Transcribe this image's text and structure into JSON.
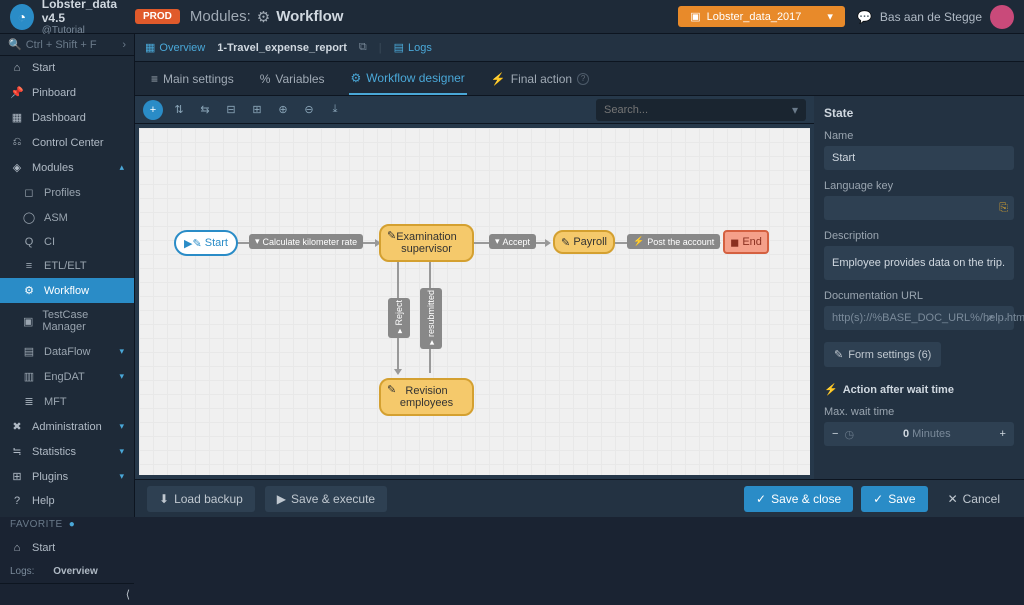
{
  "app": {
    "name": "Lobster_data v4.5",
    "subtitle": "@Tutorial"
  },
  "header": {
    "env_badge": "PROD",
    "module_label": "Modules:",
    "page_title": "Workflow",
    "project": "Lobster_data_2017",
    "user": "Bas aan de Stegge"
  },
  "sidebar": {
    "search_placeholder": "Ctrl + Shift + F",
    "items": [
      {
        "icon": "⌂",
        "label": "Start"
      },
      {
        "icon": "📌",
        "label": "Pinboard"
      },
      {
        "icon": "▦",
        "label": "Dashboard"
      },
      {
        "icon": "⎌",
        "label": "Control Center"
      },
      {
        "icon": "◈",
        "label": "Modules"
      }
    ],
    "modules": [
      {
        "icon": "◻",
        "label": "Profiles"
      },
      {
        "icon": "◯",
        "label": "ASM"
      },
      {
        "icon": "Q",
        "label": "CI"
      },
      {
        "icon": "≡",
        "label": "ETL/ELT"
      },
      {
        "icon": "⚙",
        "label": "Workflow"
      },
      {
        "icon": "▣",
        "label": "TestCase Manager"
      },
      {
        "icon": "▤",
        "label": "DataFlow"
      },
      {
        "icon": "▥",
        "label": "EngDAT"
      },
      {
        "icon": "≣",
        "label": "MFT"
      }
    ],
    "bottom": [
      {
        "icon": "✖",
        "label": "Administration"
      },
      {
        "icon": "≒",
        "label": "Statistics"
      },
      {
        "icon": "⊞",
        "label": "Plugins"
      },
      {
        "icon": "?",
        "label": "Help"
      }
    ],
    "favorite_label": "FAVORITE",
    "favorites": [
      {
        "icon": "⌂",
        "label": "Start"
      },
      {
        "label_prefix": "Logs:",
        "label": "Overview"
      }
    ]
  },
  "breadcrumb": {
    "overview": "Overview",
    "current": "1-Travel_expense_report",
    "logs": "Logs"
  },
  "tabs": {
    "main": "Main settings",
    "vars": "Variables",
    "designer": "Workflow designer",
    "final": "Final action"
  },
  "toolbar": {
    "search_placeholder": "Search..."
  },
  "nodes": {
    "start": "Start",
    "exam": "Examination supervisor",
    "payroll": "Payroll",
    "revision": "Revision employees",
    "end": "End"
  },
  "edges": {
    "calc": "Calculate kilometer rate",
    "accept": "Accept",
    "post": "Post the account",
    "reject": "Reject",
    "resubmit": "resubmitted"
  },
  "panel": {
    "title": "State",
    "name_label": "Name",
    "name_value": "Start",
    "lang_label": "Language key",
    "lang_value": "",
    "desc_label": "Description",
    "desc_value": "Employee provides data on the trip.",
    "doc_label": "Documentation URL",
    "doc_value": "http(s)://%BASE_DOC_URL%/help.html",
    "form_btn": "Form settings (6)",
    "action_header": "Action after wait time",
    "wait_label": "Max. wait time",
    "wait_value": "0",
    "wait_unit": "Minutes"
  },
  "footer": {
    "load": "Load backup",
    "exec": "Save & execute",
    "save_close": "Save & close",
    "save": "Save",
    "cancel": "Cancel"
  }
}
